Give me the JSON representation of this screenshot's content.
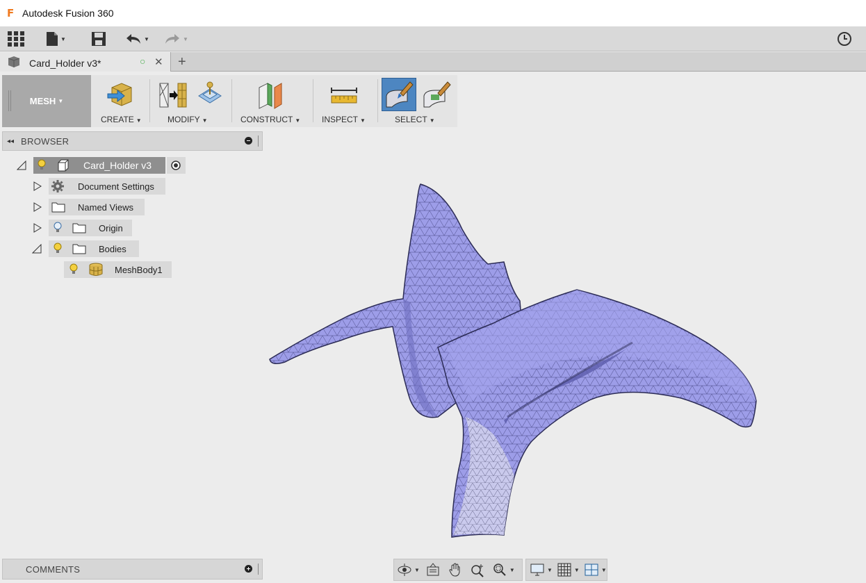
{
  "window": {
    "title": "Autodesk Fusion 360",
    "logo_letter": "F"
  },
  "document_tab": {
    "label": "Card_Holder v3*",
    "close_glyph": "✕",
    "status_glyph": "○"
  },
  "workspace": {
    "label": "MESH"
  },
  "toolbar": {
    "groups": [
      {
        "label": "CREATE"
      },
      {
        "label": "MODIFY"
      },
      {
        "label": "CONSTRUCT"
      },
      {
        "label": "INSPECT"
      },
      {
        "label": "SELECT"
      }
    ]
  },
  "browser": {
    "title": "BROWSER",
    "root": {
      "label": "Card_Holder v3"
    },
    "items": [
      {
        "label": "Document Settings"
      },
      {
        "label": "Named Views"
      },
      {
        "label": "Origin"
      },
      {
        "label": "Bodies"
      }
    ],
    "child": {
      "label": "MeshBody1"
    }
  },
  "comments": {
    "title": "COMMENTS"
  },
  "colors": {
    "mesh_fill": "#9b9be6",
    "accent_orange": "#f07a1f",
    "select_active": "#4d86c1"
  },
  "icons": [
    "apps-grid-icon",
    "file-icon",
    "save-icon",
    "undo-icon",
    "redo-icon",
    "history-clock-icon",
    "orbit-icon",
    "look-at-icon",
    "pan-icon",
    "zoom-icon",
    "fit-icon",
    "display-settings-icon",
    "grid-settings-icon",
    "viewports-icon"
  ]
}
